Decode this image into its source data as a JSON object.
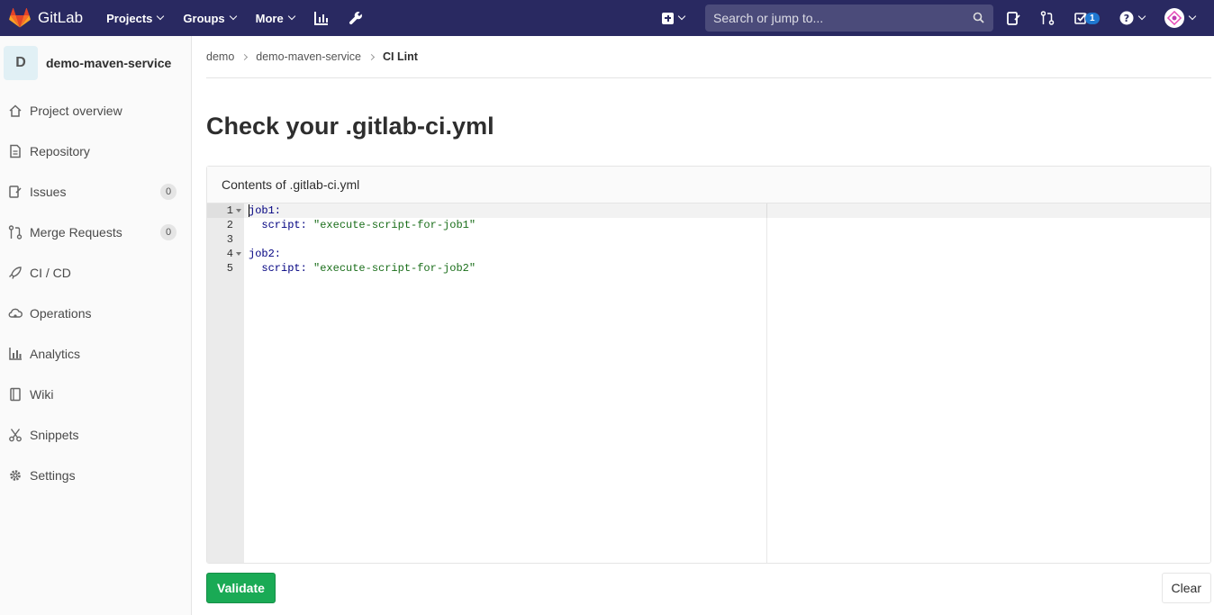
{
  "navbar": {
    "brand": "GitLab",
    "menus": [
      {
        "label": "Projects",
        "icon": "chevron-down-icon"
      },
      {
        "label": "Groups",
        "icon": "chevron-down-icon"
      },
      {
        "label": "More",
        "icon": "chevron-down-icon"
      }
    ],
    "search_placeholder": "Search or jump to...",
    "todo_count": "1",
    "colors": {
      "bg": "#292961",
      "badge": "#1f78d1"
    }
  },
  "sidebar": {
    "project_initial": "D",
    "project_name": "demo-maven-service",
    "items": [
      {
        "label": "Project overview",
        "icon": "home-icon"
      },
      {
        "label": "Repository",
        "icon": "doc-text-icon"
      },
      {
        "label": "Issues",
        "icon": "issues-icon",
        "count": "0"
      },
      {
        "label": "Merge Requests",
        "icon": "git-merge-icon",
        "count": "0"
      },
      {
        "label": "CI / CD",
        "icon": "rocket-icon"
      },
      {
        "label": "Operations",
        "icon": "cloud-gear-icon"
      },
      {
        "label": "Analytics",
        "icon": "chart-icon"
      },
      {
        "label": "Wiki",
        "icon": "book-icon"
      },
      {
        "label": "Snippets",
        "icon": "scissors-icon"
      },
      {
        "label": "Settings",
        "icon": "gear-icon"
      }
    ]
  },
  "breadcrumb": [
    "demo",
    "demo-maven-service",
    "CI Lint"
  ],
  "page_title": "Check your .gitlab-ci.yml",
  "panel_title": "Contents of .gitlab-ci.yml",
  "editor": {
    "lines": [
      {
        "num": "1",
        "fold": true,
        "key": "job1:",
        "value": ""
      },
      {
        "num": "2",
        "fold": false,
        "key": "  script: ",
        "value": "\"execute-script-for-job1\""
      },
      {
        "num": "3",
        "fold": false,
        "key": "",
        "value": ""
      },
      {
        "num": "4",
        "fold": true,
        "key": "job2:",
        "value": ""
      },
      {
        "num": "5",
        "fold": false,
        "key": "  script: ",
        "value": "\"execute-script-for-job2\""
      }
    ]
  },
  "buttons": {
    "validate": "Validate",
    "clear": "Clear"
  }
}
